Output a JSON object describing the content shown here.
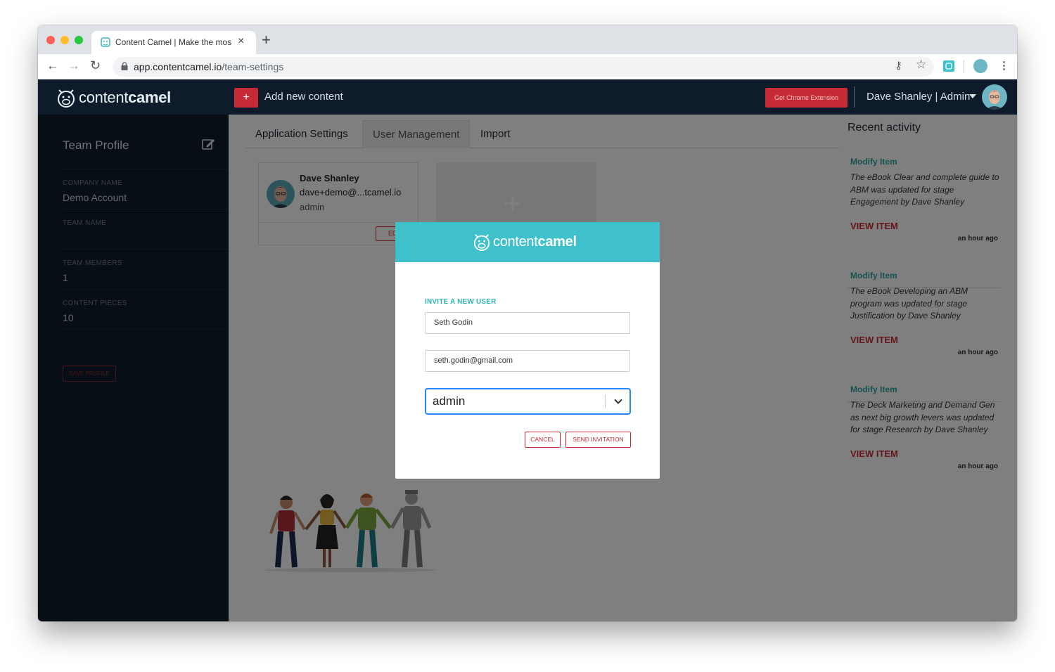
{
  "browser": {
    "tab_title": "Content Camel | Make the mos",
    "url_host": "app.contentcamel.io",
    "url_path": "/team-settings"
  },
  "header": {
    "logo_light": "content",
    "logo_bold": "camel",
    "add_label": "Add new content",
    "add_icon": "+",
    "chrome_extension": "Get Chrome Extension",
    "user_label": "Dave Shanley | Admin"
  },
  "sidebar": {
    "title": "Team Profile",
    "fields": [
      {
        "label": "COMPANY NAME",
        "value": "Demo Account"
      },
      {
        "label": "TEAM NAME",
        "value": ""
      },
      {
        "label": "TEAM MEMBERS",
        "value": "1"
      },
      {
        "label": "CONTENT PIECES",
        "value": "10"
      }
    ],
    "save_label": "SAVE PROFILE"
  },
  "main": {
    "tabs": [
      {
        "label": "Application Settings"
      },
      {
        "label": "User Management"
      },
      {
        "label": "Import"
      }
    ],
    "active_tab": "User Management",
    "user_card": {
      "name": "Dave Shanley",
      "email": "dave+demo@...tcamel.io",
      "role": "admin",
      "edit_label": "ED"
    },
    "add_card_icon": "+"
  },
  "recent": {
    "title": "Recent activity",
    "items": [
      {
        "type": "Modify Item",
        "description": "The eBook Clear and complete guide to ABM was updated for stage Engagement by Dave Shanley",
        "link": "VIEW ITEM",
        "time": "an hour ago"
      },
      {
        "type": "Modify Item",
        "description": "The eBook Developing an ABM program was updated for stage Justification by Dave Shanley",
        "link": "VIEW ITEM",
        "time": "an hour ago"
      },
      {
        "type": "Modify Item",
        "description": "The Deck Marketing and Demand Gen as next big growth levers was updated for stage Research by Dave Shanley",
        "link": "VIEW ITEM",
        "time": "an hour ago"
      }
    ]
  },
  "modal": {
    "logo_light": "content",
    "logo_bold": "camel",
    "invite_label": "INVITE A NEW USER",
    "name_value": "Seth Godin",
    "email_value": "seth.godin@gmail.com",
    "role_value": "admin",
    "cancel_label": "CANCEL",
    "send_label": "SEND INVITATION"
  },
  "colors": {
    "accent_red": "#c62b35",
    "teal": "#3fc1cc",
    "navy": "#0d1b2a",
    "focus_blue": "#2684ff"
  }
}
